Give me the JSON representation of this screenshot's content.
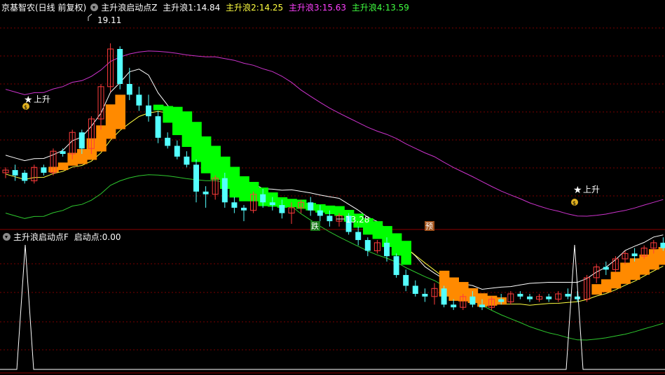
{
  "main_header": {
    "title": "京基智农(日线 前复权)",
    "indicator": "主升浪启动点Z",
    "l1_label": "主升浪1:",
    "l1_value": "14.84",
    "l2_label": "主升浪2:",
    "l2_value": "14.25",
    "l3_label": "主升浪3:",
    "l3_value": "15.63",
    "l4_label": "主升浪4:",
    "l4_value": "13.59"
  },
  "sub_header": {
    "indicator": "主升浪启动点F",
    "label": "启动点:",
    "value": "0.00"
  },
  "annotations": {
    "high_label": "19.11",
    "low_label": "13.28",
    "rise_label": "上升",
    "die_label": "跌",
    "yu_label": "预"
  },
  "colors": {
    "up": "#ff3c3c",
    "down": "#54ffff",
    "green_band": "#00ff00",
    "orange_band": "#ff8a00",
    "magenta": "#cc33cc",
    "upper": "#ffffff",
    "yellow": "#ffff40",
    "lower": "#2ec82e",
    "grid": "#7a0000"
  },
  "chart_data": {
    "type": "candlestick",
    "ylim": [
      12.4,
      20.2
    ],
    "candles": [
      [
        14.3,
        14.5,
        14.1,
        14.4
      ],
      [
        14.4,
        14.6,
        14.0,
        14.2
      ],
      [
        14.3,
        14.4,
        13.9,
        14.0
      ],
      [
        14.0,
        14.6,
        13.9,
        14.5
      ],
      [
        14.5,
        14.6,
        14.2,
        14.3
      ],
      [
        14.3,
        15.2,
        14.2,
        15.1
      ],
      [
        15.1,
        15.2,
        14.9,
        15.0
      ],
      [
        15.0,
        15.9,
        14.8,
        15.8
      ],
      [
        15.8,
        15.9,
        15.0,
        15.2
      ],
      [
        15.2,
        16.4,
        15.0,
        16.3
      ],
      [
        16.3,
        17.6,
        15.9,
        17.5
      ],
      [
        17.5,
        19.11,
        17.3,
        18.9
      ],
      [
        18.9,
        19.0,
        17.4,
        17.6
      ],
      [
        17.6,
        18.2,
        17.0,
        17.2
      ],
      [
        17.2,
        17.5,
        16.6,
        16.8
      ],
      [
        16.8,
        17.2,
        16.2,
        16.4
      ],
      [
        16.4,
        16.6,
        15.4,
        15.6
      ],
      [
        15.6,
        15.8,
        15.2,
        15.3
      ],
      [
        15.3,
        15.5,
        14.8,
        14.9
      ],
      [
        14.9,
        15.1,
        14.5,
        14.6
      ],
      [
        14.6,
        14.8,
        13.2,
        13.6
      ],
      [
        13.6,
        13.8,
        13.0,
        13.5
      ],
      [
        13.5,
        14.2,
        13.3,
        14.1
      ],
      [
        14.1,
        14.3,
        13.0,
        13.2
      ],
      [
        13.2,
        13.4,
        12.8,
        13.0
      ],
      [
        13.0,
        13.1,
        12.5,
        12.9
      ],
      [
        12.9,
        13.6,
        12.8,
        13.5
      ],
      [
        13.5,
        13.7,
        13.0,
        13.2
      ],
      [
        13.2,
        13.4,
        12.9,
        13.1
      ],
      [
        13.1,
        13.3,
        12.6,
        12.8
      ],
      [
        12.8,
        13.2,
        12.4,
        13.0
      ],
      [
        13.0,
        13.3,
        12.8,
        13.2
      ],
      [
        13.2,
        13.4,
        12.7,
        12.9
      ],
      [
        12.9,
        13.1,
        12.5,
        12.7
      ],
      [
        12.7,
        12.9,
        12.3,
        12.5
      ],
      [
        12.5,
        12.8,
        12.3,
        12.7
      ],
      [
        12.7,
        12.8,
        12.0,
        12.1
      ],
      [
        12.1,
        12.3,
        11.6,
        11.8
      ],
      [
        11.8,
        11.9,
        11.2,
        11.4
      ],
      [
        11.4,
        11.8,
        11.3,
        11.7
      ],
      [
        11.7,
        11.9,
        11.0,
        11.2
      ],
      [
        11.2,
        11.3,
        10.4,
        10.5
      ],
      [
        10.5,
        10.7,
        9.9,
        10.1
      ],
      [
        10.1,
        10.3,
        9.7,
        9.8
      ],
      [
        9.8,
        10.0,
        9.5,
        9.7
      ],
      [
        9.7,
        10.2,
        9.4,
        10.0
      ],
      [
        10.0,
        10.1,
        9.3,
        9.4
      ],
      [
        9.4,
        9.6,
        9.2,
        9.3
      ],
      [
        9.3,
        9.8,
        9.2,
        9.7
      ],
      [
        9.7,
        9.9,
        9.3,
        9.4
      ],
      [
        9.4,
        9.6,
        9.2,
        9.3
      ],
      [
        9.3,
        9.7,
        9.2,
        9.6
      ],
      [
        9.6,
        9.8,
        9.4,
        9.5
      ],
      [
        9.5,
        9.9,
        9.4,
        9.8
      ],
      [
        9.8,
        9.9,
        9.6,
        9.7
      ],
      [
        9.7,
        9.8,
        9.5,
        9.6
      ],
      [
        9.6,
        9.8,
        9.5,
        9.7
      ],
      [
        9.7,
        9.8,
        9.5,
        9.6
      ],
      [
        9.6,
        9.9,
        9.5,
        9.8
      ],
      [
        9.8,
        10.0,
        9.6,
        9.7
      ],
      [
        9.7,
        9.9,
        9.5,
        9.6
      ],
      [
        9.6,
        10.5,
        9.5,
        10.4
      ],
      [
        10.4,
        10.9,
        10.2,
        10.8
      ],
      [
        10.8,
        11.0,
        10.5,
        10.7
      ],
      [
        10.7,
        11.2,
        10.6,
        11.1
      ],
      [
        11.1,
        11.4,
        10.9,
        11.3
      ],
      [
        11.3,
        11.5,
        11.0,
        11.2
      ],
      [
        11.2,
        11.6,
        11.1,
        11.5
      ],
      [
        11.5,
        11.8,
        11.3,
        11.7
      ],
      [
        11.7,
        11.9,
        11.4,
        11.5
      ]
    ]
  }
}
